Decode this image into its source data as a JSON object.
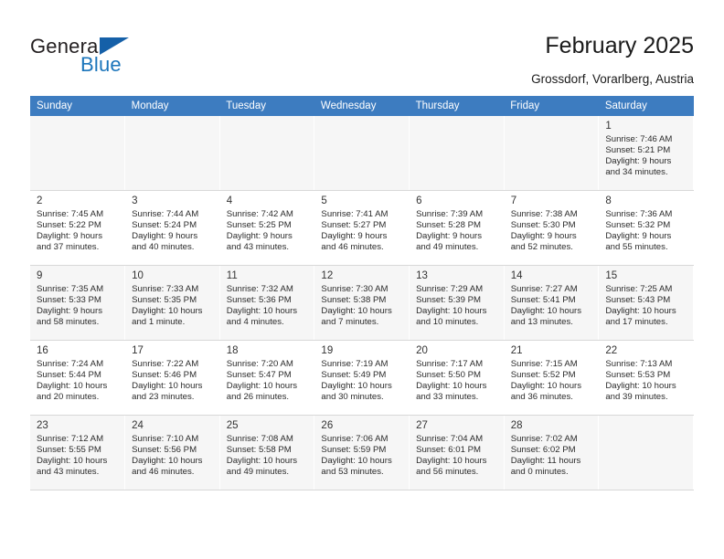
{
  "brand": {
    "word_one": "General",
    "word_two": "Blue",
    "accent_color": "#1b75bb",
    "triangle_color": "#1560a8"
  },
  "header": {
    "title": "February 2025",
    "subtitle": "Grossdorf, Vorarlberg, Austria"
  },
  "theme": {
    "header_row_bg": "#3d7cc0",
    "shaded_row_bg": "#f6f6f6",
    "grid_line": "#d8d8d8"
  },
  "calendar": {
    "columns": [
      "Sunday",
      "Monday",
      "Tuesday",
      "Wednesday",
      "Thursday",
      "Friday",
      "Saturday"
    ],
    "weeks": [
      {
        "shaded": true,
        "days": [
          null,
          null,
          null,
          null,
          null,
          null,
          {
            "day": "1",
            "sunrise": "Sunrise: 7:46 AM",
            "sunset": "Sunset: 5:21 PM",
            "daylight_line1": "Daylight: 9 hours",
            "daylight_line2": "and 34 minutes."
          }
        ]
      },
      {
        "shaded": false,
        "days": [
          {
            "day": "2",
            "sunrise": "Sunrise: 7:45 AM",
            "sunset": "Sunset: 5:22 PM",
            "daylight_line1": "Daylight: 9 hours",
            "daylight_line2": "and 37 minutes."
          },
          {
            "day": "3",
            "sunrise": "Sunrise: 7:44 AM",
            "sunset": "Sunset: 5:24 PM",
            "daylight_line1": "Daylight: 9 hours",
            "daylight_line2": "and 40 minutes."
          },
          {
            "day": "4",
            "sunrise": "Sunrise: 7:42 AM",
            "sunset": "Sunset: 5:25 PM",
            "daylight_line1": "Daylight: 9 hours",
            "daylight_line2": "and 43 minutes."
          },
          {
            "day": "5",
            "sunrise": "Sunrise: 7:41 AM",
            "sunset": "Sunset: 5:27 PM",
            "daylight_line1": "Daylight: 9 hours",
            "daylight_line2": "and 46 minutes."
          },
          {
            "day": "6",
            "sunrise": "Sunrise: 7:39 AM",
            "sunset": "Sunset: 5:28 PM",
            "daylight_line1": "Daylight: 9 hours",
            "daylight_line2": "and 49 minutes."
          },
          {
            "day": "7",
            "sunrise": "Sunrise: 7:38 AM",
            "sunset": "Sunset: 5:30 PM",
            "daylight_line1": "Daylight: 9 hours",
            "daylight_line2": "and 52 minutes."
          },
          {
            "day": "8",
            "sunrise": "Sunrise: 7:36 AM",
            "sunset": "Sunset: 5:32 PM",
            "daylight_line1": "Daylight: 9 hours",
            "daylight_line2": "and 55 minutes."
          }
        ]
      },
      {
        "shaded": true,
        "days": [
          {
            "day": "9",
            "sunrise": "Sunrise: 7:35 AM",
            "sunset": "Sunset: 5:33 PM",
            "daylight_line1": "Daylight: 9 hours",
            "daylight_line2": "and 58 minutes."
          },
          {
            "day": "10",
            "sunrise": "Sunrise: 7:33 AM",
            "sunset": "Sunset: 5:35 PM",
            "daylight_line1": "Daylight: 10 hours",
            "daylight_line2": "and 1 minute."
          },
          {
            "day": "11",
            "sunrise": "Sunrise: 7:32 AM",
            "sunset": "Sunset: 5:36 PM",
            "daylight_line1": "Daylight: 10 hours",
            "daylight_line2": "and 4 minutes."
          },
          {
            "day": "12",
            "sunrise": "Sunrise: 7:30 AM",
            "sunset": "Sunset: 5:38 PM",
            "daylight_line1": "Daylight: 10 hours",
            "daylight_line2": "and 7 minutes."
          },
          {
            "day": "13",
            "sunrise": "Sunrise: 7:29 AM",
            "sunset": "Sunset: 5:39 PM",
            "daylight_line1": "Daylight: 10 hours",
            "daylight_line2": "and 10 minutes."
          },
          {
            "day": "14",
            "sunrise": "Sunrise: 7:27 AM",
            "sunset": "Sunset: 5:41 PM",
            "daylight_line1": "Daylight: 10 hours",
            "daylight_line2": "and 13 minutes."
          },
          {
            "day": "15",
            "sunrise": "Sunrise: 7:25 AM",
            "sunset": "Sunset: 5:43 PM",
            "daylight_line1": "Daylight: 10 hours",
            "daylight_line2": "and 17 minutes."
          }
        ]
      },
      {
        "shaded": false,
        "days": [
          {
            "day": "16",
            "sunrise": "Sunrise: 7:24 AM",
            "sunset": "Sunset: 5:44 PM",
            "daylight_line1": "Daylight: 10 hours",
            "daylight_line2": "and 20 minutes."
          },
          {
            "day": "17",
            "sunrise": "Sunrise: 7:22 AM",
            "sunset": "Sunset: 5:46 PM",
            "daylight_line1": "Daylight: 10 hours",
            "daylight_line2": "and 23 minutes."
          },
          {
            "day": "18",
            "sunrise": "Sunrise: 7:20 AM",
            "sunset": "Sunset: 5:47 PM",
            "daylight_line1": "Daylight: 10 hours",
            "daylight_line2": "and 26 minutes."
          },
          {
            "day": "19",
            "sunrise": "Sunrise: 7:19 AM",
            "sunset": "Sunset: 5:49 PM",
            "daylight_line1": "Daylight: 10 hours",
            "daylight_line2": "and 30 minutes."
          },
          {
            "day": "20",
            "sunrise": "Sunrise: 7:17 AM",
            "sunset": "Sunset: 5:50 PM",
            "daylight_line1": "Daylight: 10 hours",
            "daylight_line2": "and 33 minutes."
          },
          {
            "day": "21",
            "sunrise": "Sunrise: 7:15 AM",
            "sunset": "Sunset: 5:52 PM",
            "daylight_line1": "Daylight: 10 hours",
            "daylight_line2": "and 36 minutes."
          },
          {
            "day": "22",
            "sunrise": "Sunrise: 7:13 AM",
            "sunset": "Sunset: 5:53 PM",
            "daylight_line1": "Daylight: 10 hours",
            "daylight_line2": "and 39 minutes."
          }
        ]
      },
      {
        "shaded": true,
        "days": [
          {
            "day": "23",
            "sunrise": "Sunrise: 7:12 AM",
            "sunset": "Sunset: 5:55 PM",
            "daylight_line1": "Daylight: 10 hours",
            "daylight_line2": "and 43 minutes."
          },
          {
            "day": "24",
            "sunrise": "Sunrise: 7:10 AM",
            "sunset": "Sunset: 5:56 PM",
            "daylight_line1": "Daylight: 10 hours",
            "daylight_line2": "and 46 minutes."
          },
          {
            "day": "25",
            "sunrise": "Sunrise: 7:08 AM",
            "sunset": "Sunset: 5:58 PM",
            "daylight_line1": "Daylight: 10 hours",
            "daylight_line2": "and 49 minutes."
          },
          {
            "day": "26",
            "sunrise": "Sunrise: 7:06 AM",
            "sunset": "Sunset: 5:59 PM",
            "daylight_line1": "Daylight: 10 hours",
            "daylight_line2": "and 53 minutes."
          },
          {
            "day": "27",
            "sunrise": "Sunrise: 7:04 AM",
            "sunset": "Sunset: 6:01 PM",
            "daylight_line1": "Daylight: 10 hours",
            "daylight_line2": "and 56 minutes."
          },
          {
            "day": "28",
            "sunrise": "Sunrise: 7:02 AM",
            "sunset": "Sunset: 6:02 PM",
            "daylight_line1": "Daylight: 11 hours",
            "daylight_line2": "and 0 minutes."
          },
          null
        ]
      }
    ]
  }
}
